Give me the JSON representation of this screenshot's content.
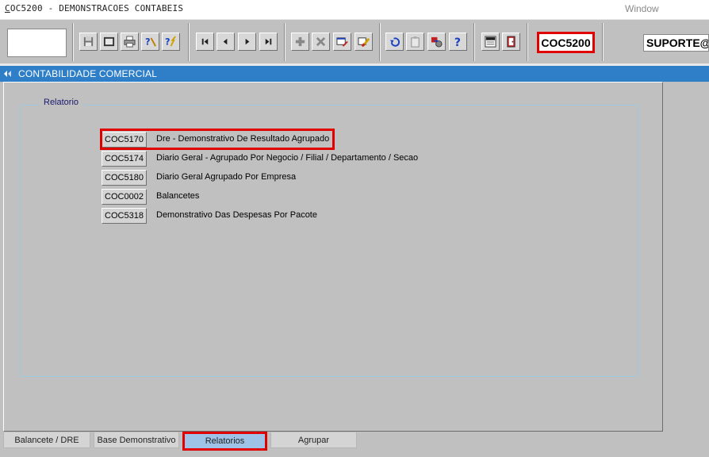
{
  "window": {
    "title_underlined": "C",
    "title_rest": "OC5200 - DEMONSTRACOES CONTABEIS",
    "menu_window": "Window"
  },
  "toolbar": {
    "form_code": "COC5200",
    "user": "SUPORTE@",
    "buttons": [
      {
        "name": "save-icon"
      },
      {
        "name": "window-icon"
      },
      {
        "name": "print-icon"
      },
      {
        "name": "query-help-icon"
      },
      {
        "name": "execute-query-icon"
      },
      {
        "name": "first-record-icon"
      },
      {
        "name": "previous-record-icon"
      },
      {
        "name": "next-record-icon"
      },
      {
        "name": "last-record-icon"
      },
      {
        "name": "insert-record-icon"
      },
      {
        "name": "delete-record-icon"
      },
      {
        "name": "edit-record-icon"
      },
      {
        "name": "clear-record-icon"
      },
      {
        "name": "undo-icon"
      },
      {
        "name": "clipboard-icon"
      },
      {
        "name": "settings-icon"
      },
      {
        "name": "help-icon"
      },
      {
        "name": "menu-icon"
      },
      {
        "name": "exit-icon"
      }
    ]
  },
  "module": {
    "title": "CONTABILIDADE COMERCIAL"
  },
  "group": {
    "label": "Relatorio"
  },
  "reports": [
    {
      "code": "COC5170",
      "label": "Dre - Demonstrativo De Resultado Agrupado"
    },
    {
      "code": "COC5174",
      "label": "Diario Geral - Agrupado Por Negocio / Filial / Departamento / Secao"
    },
    {
      "code": "COC5180",
      "label": "Diario Geral Agrupado Por Empresa"
    },
    {
      "code": "COC0002",
      "label": "Balancetes"
    },
    {
      "code": "COC5318",
      "label": "Demonstrativo Das Despesas Por Pacote"
    }
  ],
  "tabs": [
    {
      "label": "Balancete / DRE"
    },
    {
      "label": "Base Demonstrativo"
    },
    {
      "label": "Relatorios"
    },
    {
      "label": "Agrupar"
    }
  ],
  "colors": {
    "module_bar": "#2f7fc8",
    "highlight": "#e00000",
    "active_tab": "#9fc3e6"
  }
}
